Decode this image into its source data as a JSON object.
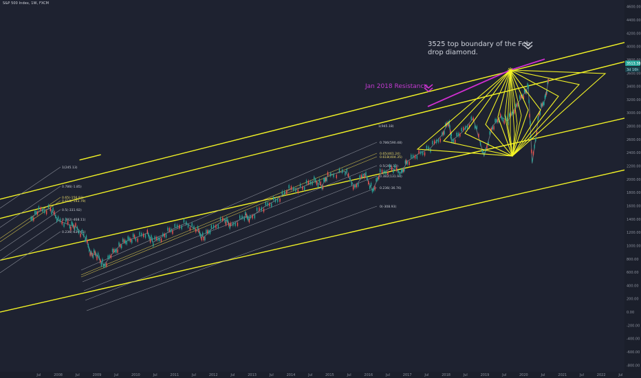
{
  "header": {
    "title": "S&P 500 Index, 1W, FXCM"
  },
  "annotations": {
    "feb_drop": "3525 top boundary of the Feb drop diamond.",
    "jan_2018": "Jan 2018 Resistance"
  },
  "price_badges": {
    "upper": "3513.38",
    "lower": "3d 16h"
  },
  "colors": {
    "background": "#1e2230",
    "channel": "#f5f525",
    "diamond": "#f5f525",
    "resistance": "#d12fd1",
    "fib_lines": "#8a8e98",
    "fib_gold": "#c9b94b",
    "candle_up": "#26a69a",
    "candle_down": "#ef5350",
    "badge_top": "#26a69a",
    "badge_bottom": "#1b3f4a",
    "text": "#d1d4dc"
  },
  "chart_data": {
    "type": "line",
    "title": "S&P 500 Index, 1W, FXCM",
    "y_axis": {
      "ticks": [
        "4600.00",
        "4400.00",
        "4200.00",
        "4000.00",
        "3800.00",
        "3600.00",
        "3400.00",
        "3200.00",
        "3000.00",
        "2800.00",
        "2600.00",
        "2400.00",
        "2200.00",
        "2000.00",
        "1800.00",
        "1600.00",
        "1400.00",
        "1200.00",
        "1000.00",
        "800.00",
        "600.00",
        "400.00",
        "200.00",
        "0.00",
        "-200.00",
        "-400.00",
        "-600.00",
        "-800.00"
      ],
      "ylim": [
        -900,
        4700
      ]
    },
    "x_axis": {
      "ticks": [
        "Jul",
        "2008",
        "Jul",
        "2009",
        "Jul",
        "2010",
        "Jul",
        "2011",
        "Jul",
        "2012",
        "Jul",
        "2013",
        "Jul",
        "2014",
        "Jul",
        "2015",
        "Jul",
        "2016",
        "Jul",
        "2017",
        "Jul",
        "2018",
        "Jul",
        "2019",
        "Jul",
        "2020",
        "Jul",
        "2021",
        "Jul",
        "2022",
        "Jul",
        "2023"
      ]
    },
    "series": [
      {
        "values": [
          [
            2007.3,
            1410
          ],
          [
            2007.5,
            1520
          ],
          [
            2007.8,
            1560
          ],
          [
            2008.0,
            1380
          ],
          [
            2008.3,
            1310
          ],
          [
            2008.45,
            1290
          ],
          [
            2008.7,
            1120
          ],
          [
            2008.85,
            880
          ],
          [
            2009.0,
            860
          ],
          [
            2009.17,
            700
          ],
          [
            2009.4,
            880
          ],
          [
            2009.6,
            1010
          ],
          [
            2009.8,
            1080
          ],
          [
            2010.0,
            1120
          ],
          [
            2010.3,
            1190
          ],
          [
            2010.45,
            1050
          ],
          [
            2010.7,
            1150
          ],
          [
            2010.95,
            1250
          ],
          [
            2011.3,
            1340
          ],
          [
            2011.6,
            1220
          ],
          [
            2011.75,
            1120
          ],
          [
            2011.95,
            1250
          ],
          [
            2012.3,
            1400
          ],
          [
            2012.45,
            1300
          ],
          [
            2012.8,
            1440
          ],
          [
            2012.95,
            1420
          ],
          [
            2013.3,
            1580
          ],
          [
            2013.6,
            1680
          ],
          [
            2013.95,
            1840
          ],
          [
            2014.3,
            1880
          ],
          [
            2014.6,
            1980
          ],
          [
            2014.8,
            1900
          ],
          [
            2014.95,
            2060
          ],
          [
            2015.4,
            2120
          ],
          [
            2015.65,
            1880
          ],
          [
            2015.9,
            2090
          ],
          [
            2016.1,
            1830
          ],
          [
            2016.3,
            2080
          ],
          [
            2016.6,
            2170
          ],
          [
            2016.85,
            2090
          ],
          [
            2017.0,
            2270
          ],
          [
            2017.3,
            2390
          ],
          [
            2017.6,
            2470
          ],
          [
            2017.9,
            2670
          ],
          [
            2018.07,
            2870
          ],
          [
            2018.15,
            2580
          ],
          [
            2018.4,
            2700
          ],
          [
            2018.7,
            2920
          ],
          [
            2018.98,
            2350
          ],
          [
            2019.2,
            2800
          ],
          [
            2019.4,
            2940
          ],
          [
            2019.6,
            2880
          ],
          [
            2019.8,
            3100
          ],
          [
            2020.0,
            3280
          ],
          [
            2020.12,
            3390
          ],
          [
            2020.22,
            2240
          ],
          [
            2020.4,
            3000
          ],
          [
            2020.55,
            3200
          ],
          [
            2020.65,
            3513
          ]
        ]
      }
    ],
    "channel": {
      "upper": [
        [
          2006.5,
          1700
        ],
        [
          2022.6,
          4060
        ]
      ],
      "middle": [
        [
          2006.5,
          1410
        ],
        [
          2022.6,
          3770
        ]
      ],
      "lower": [
        [
          2006.5,
          780
        ],
        [
          2022.6,
          2920
        ]
      ],
      "bottom": [
        [
          2006.5,
          0
        ],
        [
          2022.6,
          2140
        ]
      ],
      "far_left_stub": [
        [
          2008.55,
          2290
        ],
        [
          2009.1,
          2370
        ]
      ]
    },
    "fib_sets": [
      {
        "labels": [
          "1(245.13)",
          "0.786(-1.85)",
          "0.65(-156.93)",
          "0.618(-193.79)",
          "0.5(-331.92)",
          "0.382(-468.11)",
          "0.236(-636.61)"
        ]
      },
      {
        "labels": [
          "1(945.18)",
          "0.786(590.48)",
          "0.65(461.24)",
          "0.618(404.35)",
          "0.5(268.13)",
          "0.382(131.94)",
          "0.236(-36.76)",
          "0(-308.93)"
        ]
      }
    ]
  }
}
